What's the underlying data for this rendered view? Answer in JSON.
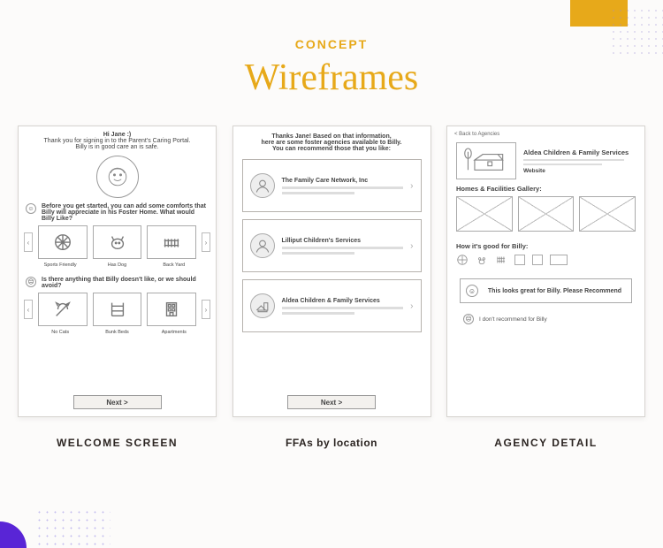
{
  "header": {
    "eyebrow": "CONCEPT",
    "title": "Wireframes"
  },
  "screens": [
    {
      "caption": "WELCOME SCREEN",
      "greeting_line1": "Hi Jane :)",
      "greeting_line2": "Thank you for signing in to the Parent's Caring Portal.",
      "greeting_line3": "Billy is in good care an is safe.",
      "q1": "Before you get started, you can add some comforts that Billy will appreciate in his Foster Home. What would Billy Like?",
      "tiles1": [
        "Sports Friendly",
        "Has Dog",
        "Back Yard"
      ],
      "q2": "Is there anything that Billy doesn't like, or we should avoid?",
      "tiles2": [
        "No Cats",
        "Bunk Beds",
        "Apartments"
      ],
      "next": "Next >"
    },
    {
      "caption": "FFAs by location",
      "intro_line1": "Thanks Jane! Based on that information,",
      "intro_line2": "here are some foster agencies available to Billy.",
      "intro_line3": "You can recommend those that you like:",
      "agencies": [
        "The Family Care Network, Inc",
        "Lilliput Children's Services",
        "Aldea Children & Family Services"
      ],
      "next": "Next >"
    },
    {
      "caption": "AGENCY DETAIL",
      "back": "< Back to Agencies",
      "agency_name": "Aldea Children & Family Services",
      "website": "Website",
      "gallery_head": "Homes & Facilities Gallery:",
      "goodfor_head": "How it's good for Billy:",
      "recommend": "This looks great for Billy. Please Recommend",
      "dont_recommend": "I don't recommend for Billy"
    }
  ]
}
